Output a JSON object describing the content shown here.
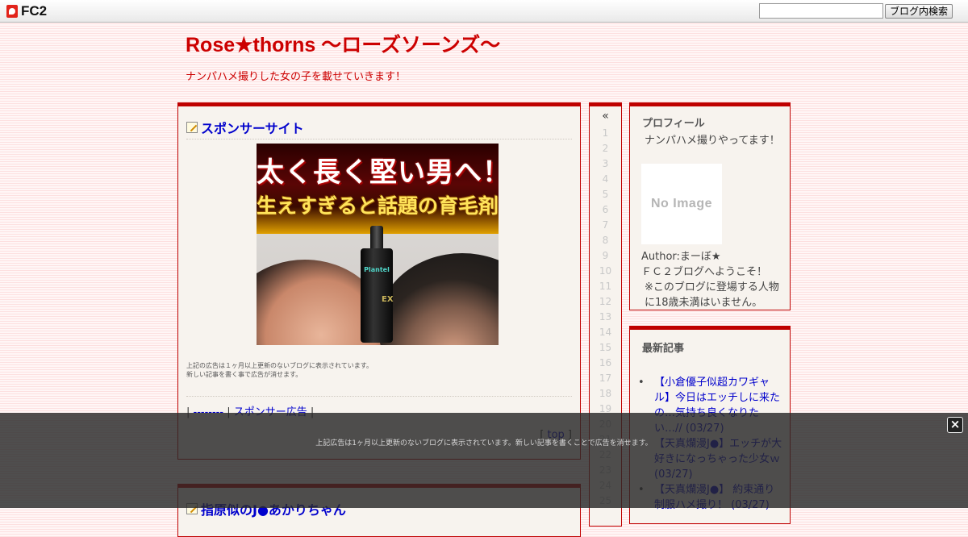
{
  "fc2bar": {
    "logo": "FC2",
    "search_placeholder": "",
    "search_button": "ブログ内検索"
  },
  "blog": {
    "title": "Rose★thorns ～ローズソーンズ～",
    "description": "ナンパハメ撮りした女の子を載せていきます！"
  },
  "entry1": {
    "title": "スポンサーサイト",
    "ad": {
      "line1": "太く長く堅い男へ！",
      "line2": "生えすぎると話題の育毛剤",
      "product": "Plantel",
      "product_mark": "EX"
    },
    "ad_note_1": "上記の広告は１ヶ月以上更新のないブログに表示されています。",
    "ad_note_2": "新しい記事を書く事で広告が消せます。",
    "link_sep_1": "|",
    "link_a": "--------",
    "link_sep_2": "|",
    "link_b": "スポンサー広告",
    "link_sep_3": "|",
    "top_open": "[",
    "top_link": "top",
    "top_close": "]"
  },
  "entry2": {
    "title": "指原似のJ●あかりちゃん"
  },
  "calendar": {
    "prev": "«",
    "days": [
      "1",
      "2",
      "3",
      "4",
      "5",
      "6",
      "7",
      "8",
      "9",
      "10",
      "11",
      "12",
      "13",
      "14",
      "15",
      "16",
      "17",
      "18",
      "19",
      "20",
      "21",
      "22",
      "23",
      "24",
      "25"
    ]
  },
  "profile": {
    "heading": "プロフィール",
    "intro": "ナンパハメ撮りやってます！",
    "image_text": "No Image",
    "author": "Author:まーぼ★",
    "welcome": "ＦＣ２ブログへようこそ！",
    "note": "※このブログに登場する人物に18歳未満はいません。"
  },
  "recent": {
    "heading": "最新記事",
    "items": [
      {
        "title": "【小倉優子似超カワギャル】今日はエッチしに来たの…気持ち良くなりたい…//",
        "date": "(03/27)"
      },
      {
        "title": "【天真爛漫J●】エッチが大好きになっちゃった少女ｗ",
        "date": "(03/27)"
      },
      {
        "title": "【天真爛漫J●】 約束通り制服ハメ撮り！",
        "date": "(03/27)"
      }
    ]
  },
  "overlay": {
    "text": "上記広告は1ヶ月以上更新のないブログに表示されています。新しい記事を書くことで広告を消せます。",
    "close": "×"
  },
  "colors": {
    "accent": "#bf0000",
    "title": "#cc0000",
    "link": "#0000cc"
  }
}
